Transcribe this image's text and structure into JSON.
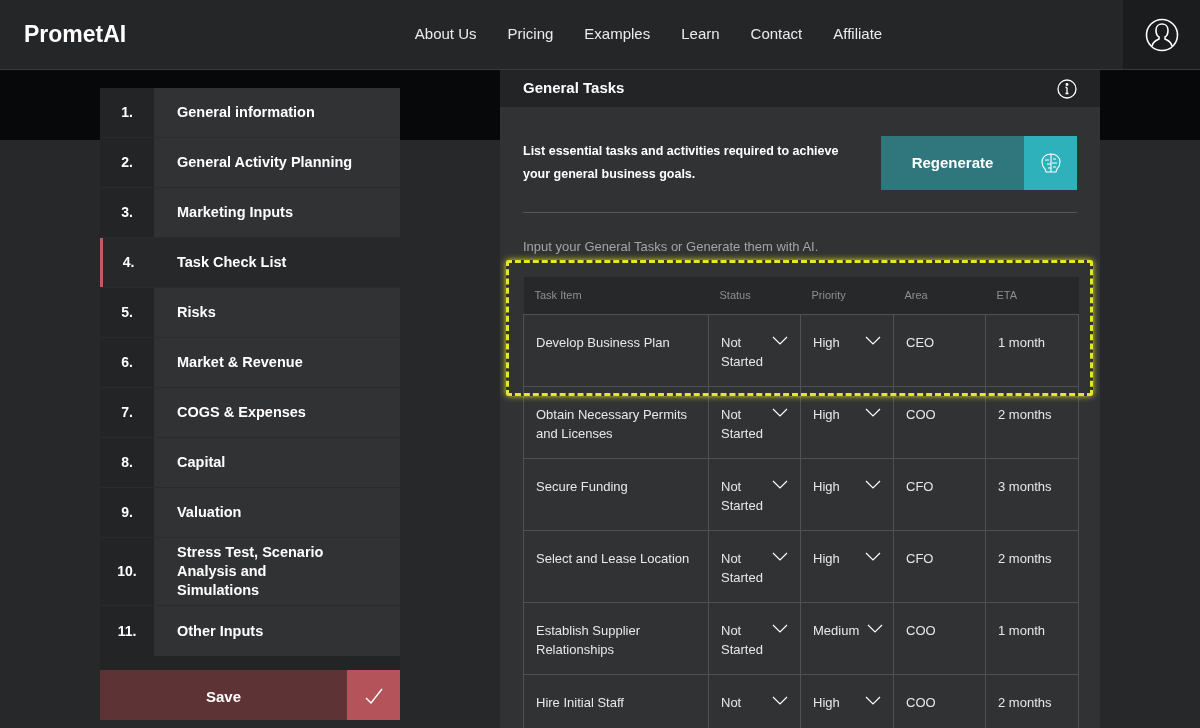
{
  "brand": "PrometAI",
  "nav": [
    "About Us",
    "Pricing",
    "Examples",
    "Learn",
    "Contact",
    "Affiliate"
  ],
  "steps": [
    {
      "number": "1.",
      "label": "General information",
      "selected": false
    },
    {
      "number": "2.",
      "label": "General Activity Planning",
      "selected": false
    },
    {
      "number": "3.",
      "label": "Marketing Inputs",
      "selected": false
    },
    {
      "number": "4.",
      "label": "Task Check List",
      "selected": true
    },
    {
      "number": "5.",
      "label": "Risks",
      "selected": false
    },
    {
      "number": "6.",
      "label": "Market & Revenue",
      "selected": false
    },
    {
      "number": "7.",
      "label": "COGS & Expenses",
      "selected": false
    },
    {
      "number": "8.",
      "label": "Capital",
      "selected": false
    },
    {
      "number": "9.",
      "label": "Valuation",
      "selected": false
    },
    {
      "number": "10.",
      "label": "Stress Test, Scenario Analysis and Simulations",
      "selected": false
    },
    {
      "number": "11.",
      "label": "Other Inputs",
      "selected": false
    }
  ],
  "save_button": "Save",
  "panel": {
    "title": "General Tasks",
    "description": "List essential tasks and activities required to achieve your general business goals.",
    "regenerate_button": "Regenerate",
    "hint": "Input your General Tasks or Generate them with AI.",
    "table": {
      "columns": [
        "Task Item",
        "Status",
        "Priority",
        "Area",
        "ETA"
      ],
      "rows": [
        {
          "task": "Develop Business Plan",
          "status": "Not Started",
          "priority": "High",
          "area": "CEO",
          "eta": "1 month",
          "highlighted": true
        },
        {
          "task": "Obtain Necessary Permits and Licenses",
          "status": "Not Started",
          "priority": "High",
          "area": "COO",
          "eta": "2 months",
          "highlighted": false
        },
        {
          "task": "Secure Funding",
          "status": "Not Started",
          "priority": "High",
          "area": "CFO",
          "eta": "3 months",
          "highlighted": false
        },
        {
          "task": "Select and Lease Location",
          "status": "Not Started",
          "priority": "High",
          "area": "CFO",
          "eta": "2 months",
          "highlighted": false
        },
        {
          "task": "Establish Supplier Relationships",
          "status": "Not Started",
          "priority": "Medium",
          "area": "COO",
          "eta": "1 month",
          "highlighted": false
        },
        {
          "task": "Hire Initial Staff",
          "status": "Not",
          "priority": "High",
          "area": "COO",
          "eta": "2 months",
          "highlighted": false
        }
      ]
    }
  }
}
